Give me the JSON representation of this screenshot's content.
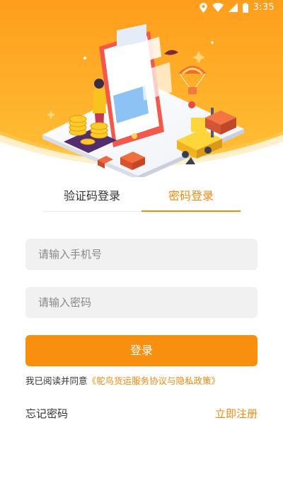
{
  "status_bar": {
    "time": "3:35",
    "icons": [
      "location-icon",
      "wifi-icon",
      "signal-icon",
      "battery-icon"
    ]
  },
  "colors": {
    "accent": "#f4880e",
    "button": "#f88f0e",
    "hero_top": "#ff9a1a",
    "hero_bottom": "#ffc43a",
    "input_bg": "#f1f1f1"
  },
  "tabs": [
    {
      "label": "验证码登录",
      "active": false
    },
    {
      "label": "密码登录",
      "active": true
    }
  ],
  "form": {
    "phone_placeholder": "请输入手机号",
    "password_placeholder": "请输入密码",
    "login_label": "登录"
  },
  "agreement": {
    "prefix": "我已阅读并同意",
    "link": "《鸵鸟货运服务协议与隐私政策》"
  },
  "links": {
    "forgot": "忘记密码",
    "register": "立即注册"
  }
}
